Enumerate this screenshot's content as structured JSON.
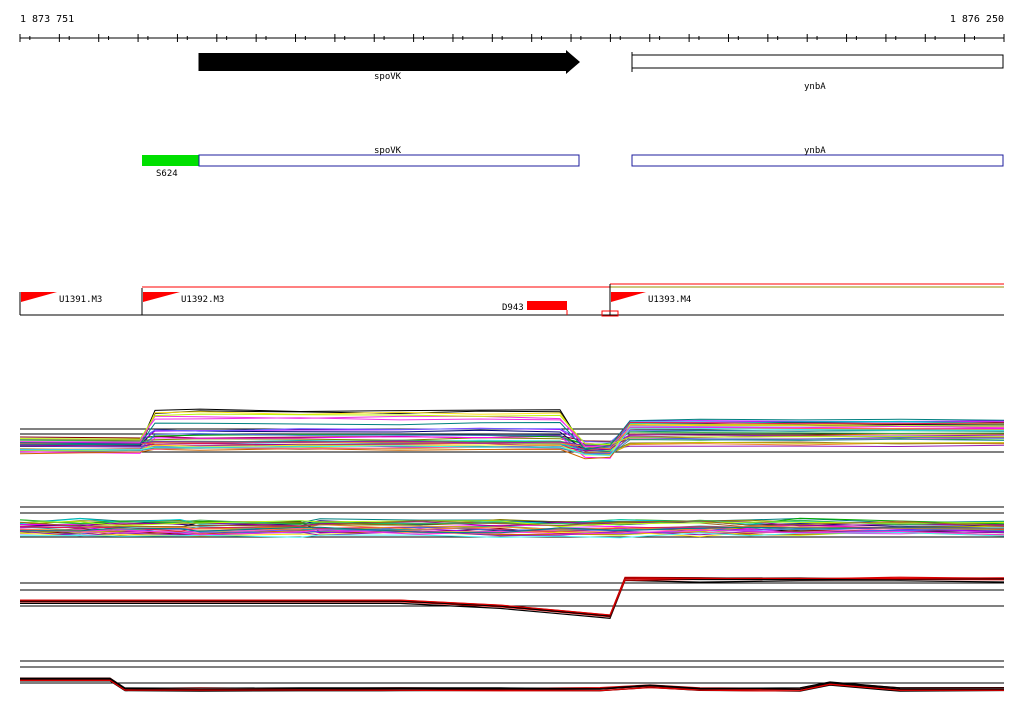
{
  "genome": {
    "start_label": "1 873 751",
    "end_label": "1 876 250",
    "start": 1873751,
    "end": 1876250,
    "tick_count": 25
  },
  "colors": {
    "gene_fill": "#000000",
    "annotation_outline": "#1c1c9c",
    "start_site": "#00e000",
    "tu_flag": "#ff0000",
    "promoter_box": "#ff0000",
    "track_line": "#000000"
  },
  "genes": [
    {
      "name": "spoVK",
      "strand": "+",
      "filled": true
    },
    {
      "name": "ynbA",
      "strand": "+",
      "filled": false
    }
  ],
  "annotations": [
    {
      "name": "spoVK",
      "start_site_label": "S624"
    },
    {
      "name": "ynbA"
    }
  ],
  "transcription_units": [
    {
      "name": "U1391.M3"
    },
    {
      "name": "U1392.M3"
    },
    {
      "name": "U1393.M4"
    }
  ],
  "regulatory": [
    {
      "name": "D943"
    }
  ],
  "expression_tracks": [
    {
      "id": "track-1",
      "style": "multicolor"
    },
    {
      "id": "track-2",
      "style": "multicolor"
    },
    {
      "id": "track-3",
      "style": "black-red"
    },
    {
      "id": "track-4",
      "style": "black-red"
    }
  ]
}
